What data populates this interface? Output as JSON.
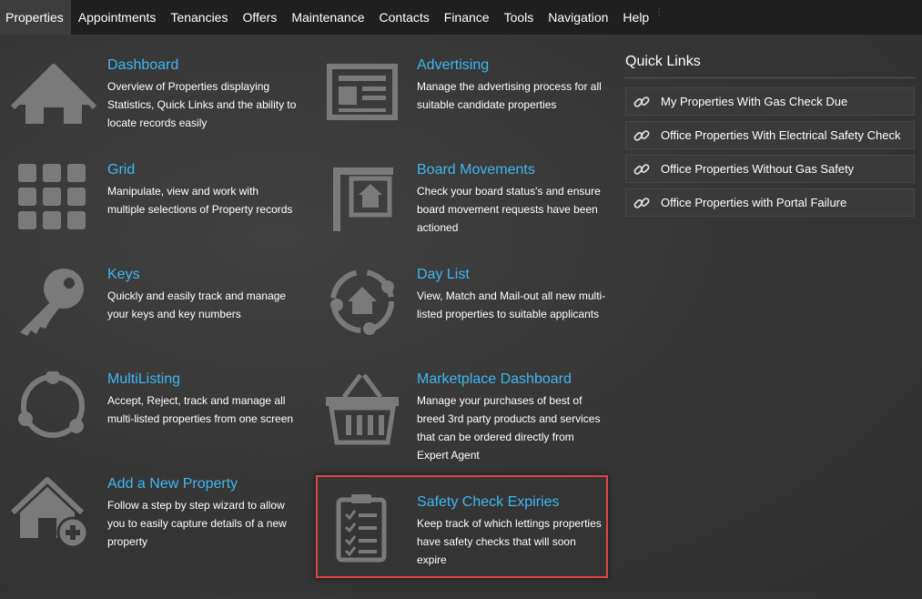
{
  "nav": {
    "items": [
      "Properties",
      "Appointments",
      "Tenancies",
      "Offers",
      "Maintenance",
      "Contacts",
      "Finance",
      "Tools",
      "Navigation",
      "Help"
    ]
  },
  "tiles": [
    {
      "icon": "house-icon",
      "title": "Dashboard",
      "desc": "Overview of Properties displaying Statistics, Quick Links and the ability to locate records easily"
    },
    {
      "icon": "newspaper-icon",
      "title": "Advertising",
      "desc": "Manage the advertising process for all suitable candidate properties"
    },
    {
      "icon": "grid-icon",
      "title": "Grid",
      "desc": "Manipulate, view and work with multiple selections of Property records"
    },
    {
      "icon": "board-sign-icon",
      "title": "Board Movements",
      "desc": "Check your board status's and ensure board movement requests have been actioned"
    },
    {
      "icon": "key-icon",
      "title": "Keys",
      "desc": "Quickly and easily track and manage your keys and key numbers"
    },
    {
      "icon": "cycle-house-icon",
      "title": "Day List",
      "desc": "View, Match and Mail-out all new multi-listed properties to suitable applicants"
    },
    {
      "icon": "network-circle-icon",
      "title": "MultiListing",
      "desc": "Accept, Reject, track and manage all multi-listed properties from one screen"
    },
    {
      "icon": "basket-icon",
      "title": "Marketplace Dashboard",
      "desc": "Manage your purchases of best of breed 3rd party products and services that can be ordered directly from Expert Agent"
    },
    {
      "icon": "house-add-icon",
      "title": "Add a New Property",
      "desc": "Follow a step by step wizard to allow you to easily capture details of a new property"
    },
    {
      "icon": "clipboard-checklist-icon",
      "title": "Safety Check Expiries",
      "desc": "Keep track of which lettings properties have safety checks that will soon expire"
    }
  ],
  "quick_links": {
    "heading": "Quick Links",
    "items": [
      "My Properties With Gas Check Due",
      "Office Properties With Electrical Safety Check",
      "Office Properties Without Gas Safety",
      "Office Properties with Portal Failure"
    ]
  },
  "colors": {
    "accent": "#3fb6f2",
    "highlight": "#e04343",
    "icon": "#7a7a7a"
  }
}
